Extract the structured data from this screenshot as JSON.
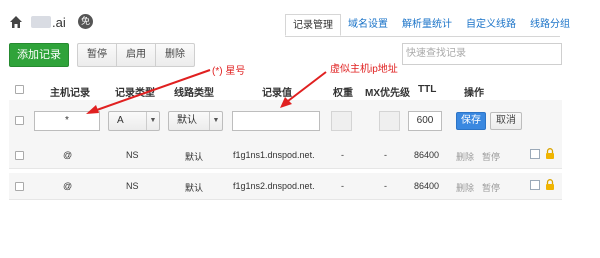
{
  "header": {
    "domain": ".ai",
    "badge": "免",
    "tabs": [
      "记录管理",
      "域名设置",
      "解析量统计",
      "自定义线路",
      "线路分组"
    ],
    "active_tab": 0
  },
  "toolbar": {
    "add_label": "添加记录",
    "pause_label": "暂停",
    "enable_label": "启用",
    "delete_label": "删除",
    "search_placeholder": "快速查找记录"
  },
  "table": {
    "columns": [
      "主机记录",
      "记录类型",
      "线路类型",
      "记录值",
      "权重",
      "MX优先级",
      "TTL",
      "操作"
    ]
  },
  "edit_row": {
    "host": "*",
    "type": "A",
    "line": "默认",
    "value": "",
    "ttl": "600",
    "save_label": "保存",
    "cancel_label": "取消"
  },
  "rows": [
    {
      "host": "@",
      "type": "NS",
      "line": "默认",
      "value": "f1g1ns1.dnspod.net.",
      "weight": "-",
      "mx": "-",
      "ttl": "86400",
      "action_delete": "删除",
      "action_pause": "暂停"
    },
    {
      "host": "@",
      "type": "NS",
      "line": "默认",
      "value": "f1g1ns2.dnspod.net.",
      "weight": "-",
      "mx": "-",
      "ttl": "86400",
      "action_delete": "删除",
      "action_pause": "暂停"
    }
  ],
  "annotations": {
    "star_note": "(*) 星号",
    "ip_note": "虚似主机ip地址",
    "color": "#e02020"
  }
}
